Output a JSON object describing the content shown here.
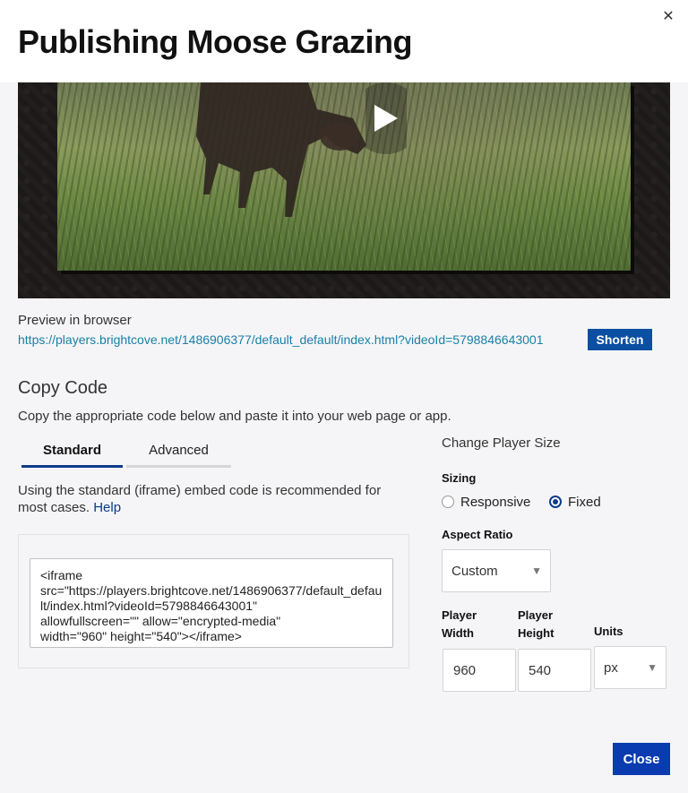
{
  "header": {
    "title": "Publishing Moose Grazing",
    "close_icon": "close-icon"
  },
  "preview": {
    "label": "Preview in browser",
    "url": "https://players.brightcove.net/1486906377/default_default/index.html?videoId=5798846643001",
    "shorten_label": "Shorten"
  },
  "copy_code": {
    "heading": "Copy Code",
    "description": "Copy the appropriate code below and paste it into your web page or app.",
    "tabs": [
      {
        "label": "Standard",
        "active": true
      },
      {
        "label": "Advanced",
        "active": false
      }
    ],
    "standard_desc": "Using the standard (iframe) embed code is recommended for most cases.",
    "help_label": "Help",
    "embed_code": "<iframe\nsrc=\"https://players.brightcove.net/1486906377/default_default/index.html?videoId=5798846643001\"\nallowfullscreen=\"\" allow=\"encrypted-media\"\nwidth=\"960\" height=\"540\"></iframe>"
  },
  "player_size": {
    "heading": "Change Player Size",
    "sizing_label": "Sizing",
    "sizing_options": [
      {
        "label": "Responsive",
        "selected": false
      },
      {
        "label": "Fixed",
        "selected": true
      }
    ],
    "aspect_ratio_label": "Aspect Ratio",
    "aspect_ratio_value": "Custom",
    "width_label": "Player Width",
    "height_label": "Player Height",
    "units_label": "Units",
    "width_value": "960",
    "height_value": "540",
    "units_value": "px"
  },
  "footer": {
    "close_label": "Close"
  },
  "colors": {
    "accent": "#0b3b8a",
    "button": "#0b4fa3",
    "link": "#1a7fa8"
  }
}
